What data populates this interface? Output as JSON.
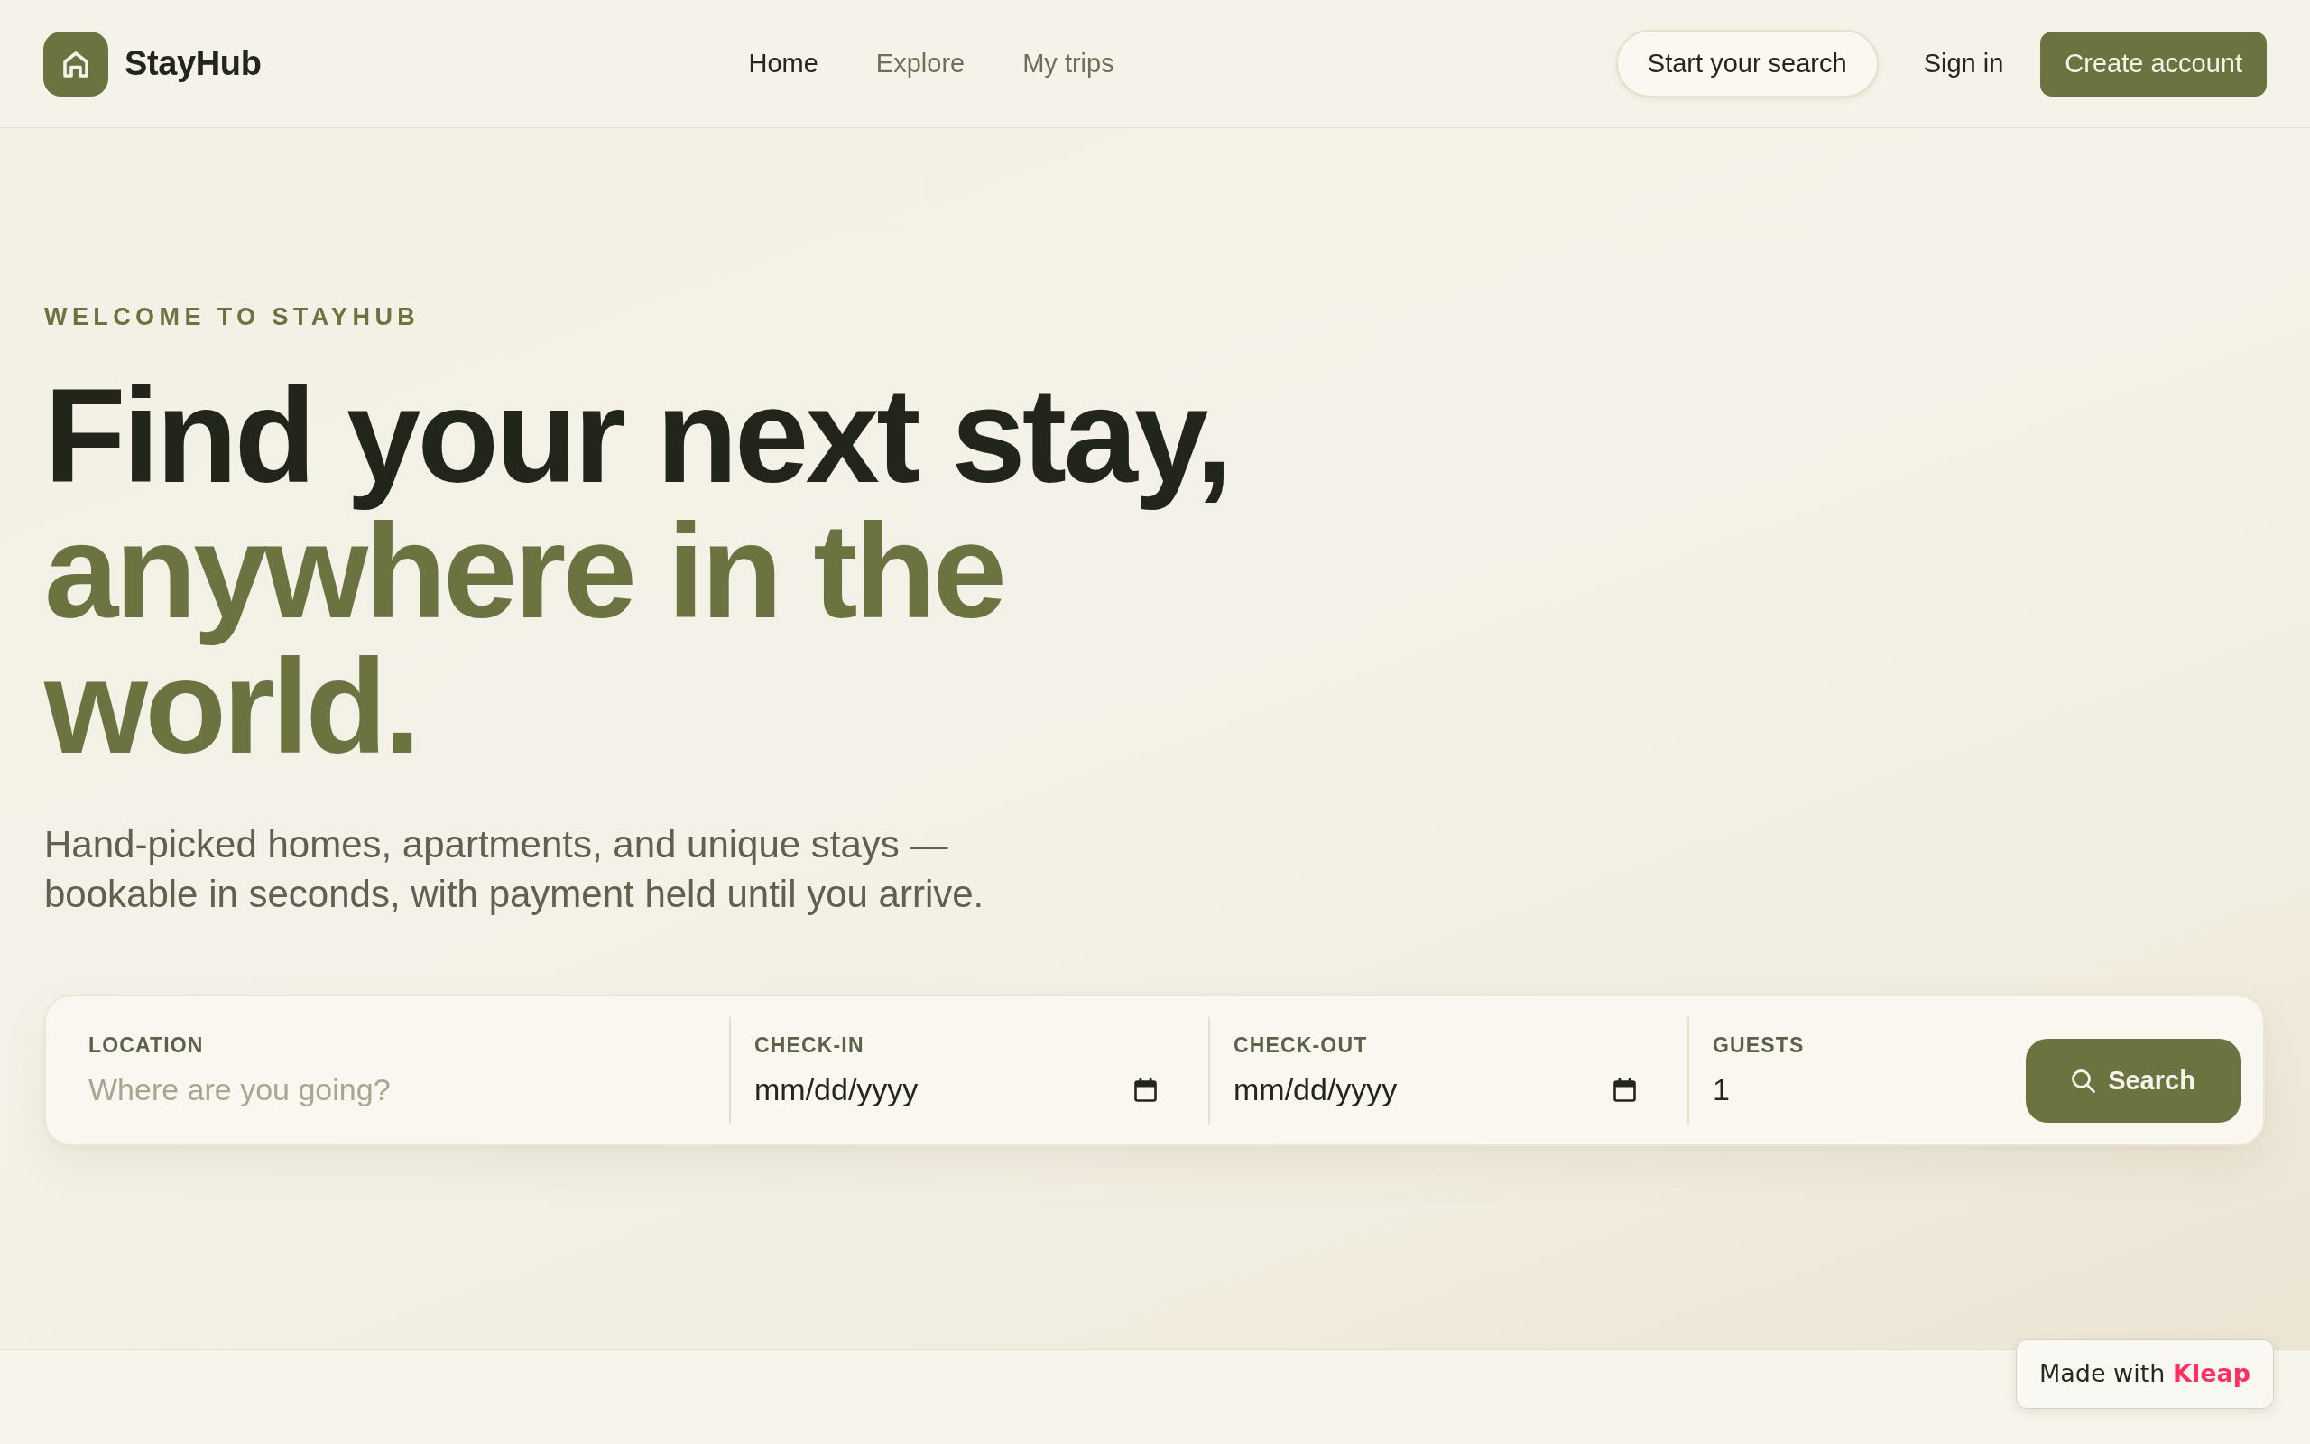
{
  "brand": {
    "name": "StayHub"
  },
  "nav": [
    {
      "label": "Home",
      "selected": true
    },
    {
      "label": "Explore",
      "selected": false
    },
    {
      "label": "My trips",
      "selected": false
    }
  ],
  "actions": [
    {
      "kind": "pill",
      "label": "Start your search"
    },
    {
      "kind": "link",
      "label": "Sign in"
    },
    {
      "kind": "primary",
      "label": "Create account"
    }
  ],
  "hero": {
    "eyebrow": "WELCOME TO STAYHUB",
    "heading": "Find your next stay,",
    "heading_highlight": "anywhere in the world.",
    "subtitle": "Hand-picked homes, apartments, and unique stays — bookable in seconds, with payment held until you arrive."
  },
  "search_form": {
    "fields": [
      {
        "kind": "text",
        "label": "LOCATION",
        "placeholder": "Where are you going?"
      },
      {
        "kind": "date",
        "label": "CHECK-IN",
        "placeholder": "mm/dd/yyyy"
      },
      {
        "kind": "date",
        "label": "CHECK-OUT",
        "placeholder": "mm/dd/yyyy"
      },
      {
        "kind": "number",
        "label": "GUESTS",
        "value": "1"
      }
    ],
    "button": "Search"
  },
  "badge": {
    "text": "Made with",
    "brand": "Kleap"
  }
}
